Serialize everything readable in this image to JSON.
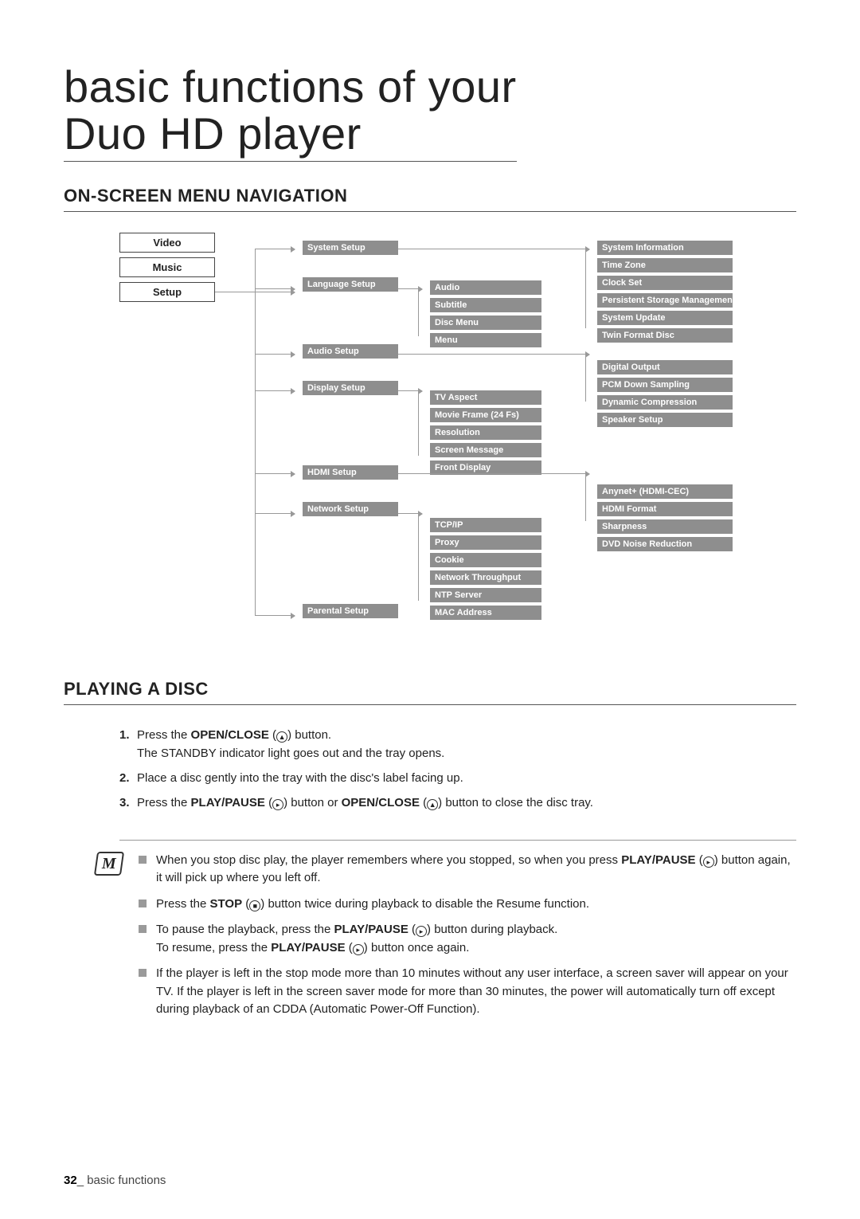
{
  "title_line1": "basic functions of your",
  "title_line2": "Duo HD player",
  "section1": "ON-SCREEN MENU NAVIGATION",
  "section2": "PLAYING A DISC",
  "root_tabs": [
    "Video",
    "Music",
    "Setup"
  ],
  "level2": [
    "System Setup",
    "Language Setup",
    "Audio Setup",
    "Display Setup",
    "HDMI Setup",
    "Network Setup",
    "Parental Setup"
  ],
  "lang_children": [
    "Audio",
    "Subtitle",
    "Disc Menu",
    "Menu"
  ],
  "display_children": [
    "TV Aspect",
    "Movie Frame (24 Fs)",
    "Resolution",
    "Screen Message",
    "Front Display"
  ],
  "network_children": [
    "TCP/IP",
    "Proxy",
    "Cookie",
    "Network Throughput",
    "NTP Server",
    "MAC Address"
  ],
  "sys_children": [
    "System Information",
    "Time Zone",
    "Clock Set",
    "Persistent Storage Management",
    "System Update",
    "Twin Format Disc"
  ],
  "audio_children": [
    "Digital Output",
    "PCM Down Sampling",
    "Dynamic Compression",
    "Speaker Setup"
  ],
  "hdmi_children": [
    "Anynet+ (HDMI-CEC)",
    "HDMI Format",
    "Sharpness",
    "DVD Noise Reduction"
  ],
  "steps": {
    "s1a": "Press the ",
    "s1b": "OPEN/CLOSE",
    "s1c": " (",
    "s1d": ") button.",
    "s1e": "The STANDBY indicator light goes out and the tray opens.",
    "s2": "Place a disc gently into the tray with the disc's label facing up.",
    "s3a": "Press the ",
    "s3b": "PLAY/PAUSE",
    "s3c": " (",
    "s3d": ") button or ",
    "s3e": "OPEN/CLOSE",
    "s3f": " (",
    "s3g": ") button to close the disc tray."
  },
  "glyphs": {
    "eject": "▲",
    "playpause": "▸",
    "stop": "■"
  },
  "notes": {
    "n1a": "When you stop disc play, the player remembers where you stopped, so when you press ",
    "n1b": "PLAY/PAUSE",
    "n1c": " (",
    "n1d": ") button again, it will pick up where you left off.",
    "n2a": "Press the ",
    "n2b": "STOP",
    "n2c": " (",
    "n2d": ") button twice during playback to disable the Resume function.",
    "n3a": "To pause the playback, press the ",
    "n3b": "PLAY/PAUSE",
    "n3c": " (",
    "n3d": ") button during playback.",
    "n3e": "To resume, press the ",
    "n3f": "PLAY/PAUSE",
    "n3g": " (",
    "n3h": ") button once again.",
    "n4": "If the player is left in the stop mode more than 10 minutes without any user interface, a screen saver will appear on your TV. If the player is left in the screen saver mode for more than 30 minutes, the power will automatically turn off except during playback of an CDDA (Automatic Power-Off Function)."
  },
  "footer_page": "32",
  "footer_sep": "_ ",
  "footer_text": "basic functions"
}
